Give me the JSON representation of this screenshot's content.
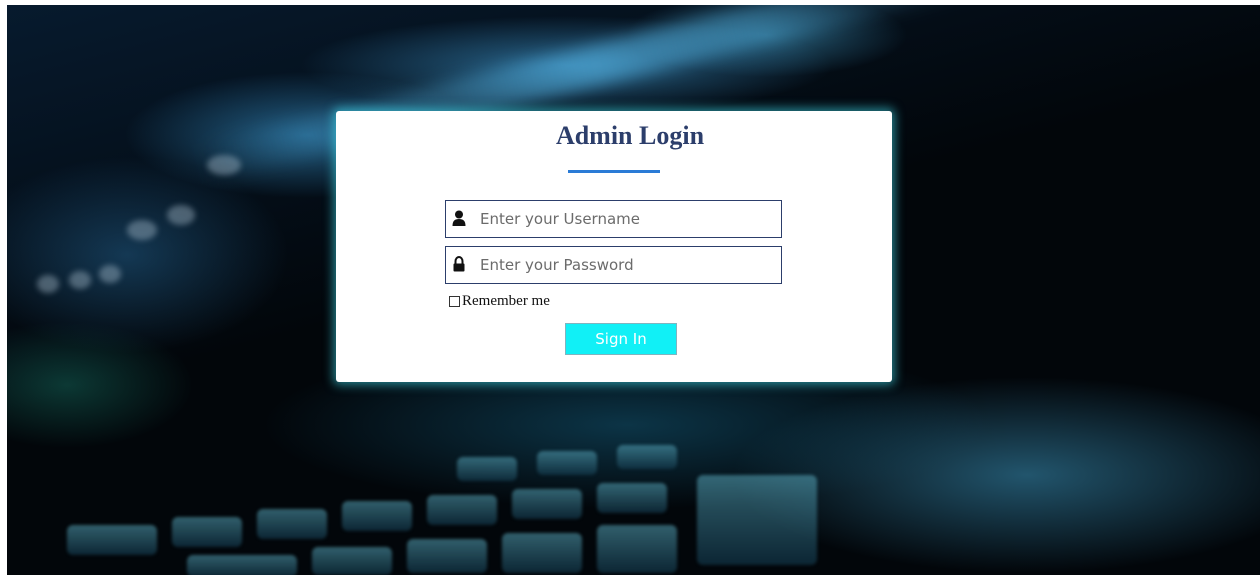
{
  "login": {
    "title": "Admin Login",
    "username": {
      "placeholder": "Enter your Username",
      "icon": "user-icon"
    },
    "password": {
      "placeholder": "Enter your Password",
      "icon": "lock-icon"
    },
    "remember_label": "Remember me",
    "remember_checked": false,
    "signin_label": "Sign In"
  },
  "colors": {
    "title": "#2c3e6b",
    "underline": "#2a7bd6",
    "signin_bg": "#11f0f6",
    "card_glow": "#40e0f0"
  }
}
